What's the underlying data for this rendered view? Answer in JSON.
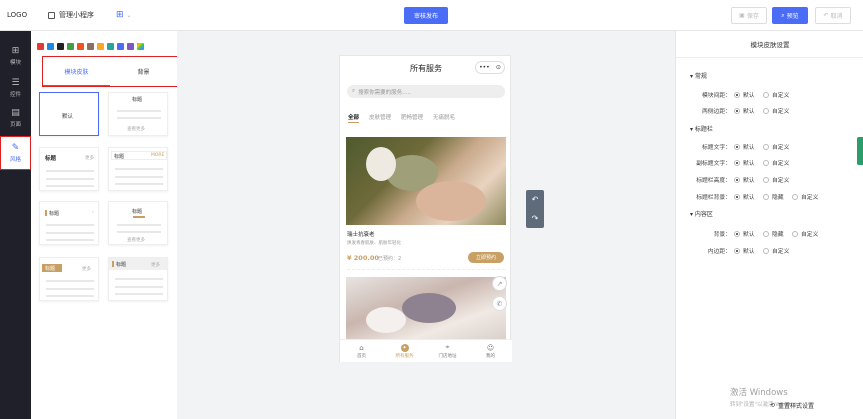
{
  "header": {
    "logo": "LOGO",
    "manage": "管理小程序",
    "submit": "审核发布",
    "save": "保存",
    "preview": "预览",
    "cancel": "取消"
  },
  "nav": [
    {
      "icon": "plus-square-icon",
      "glyph": "⊞",
      "label": "模块"
    },
    {
      "icon": "sliders-icon",
      "glyph": "☰",
      "label": "控件"
    },
    {
      "icon": "page-icon",
      "glyph": "▤",
      "label": "页面"
    },
    {
      "icon": "magic-wand-icon",
      "glyph": "✎",
      "label": "风格"
    }
  ],
  "swatch_colors": [
    "#e53935",
    "#1e88e5",
    "#212121",
    "#43a047",
    "#f4511e",
    "#8d6e63",
    "#f9a825",
    "#26a69a",
    "#4a6cf7",
    "#7e57c2"
  ],
  "skin_panel": {
    "tab_module": "模块皮肤",
    "tab_bg": "背景",
    "default": "默认",
    "title": "标题",
    "more": "查看更多",
    "more_short": "更多"
  },
  "phone": {
    "title": "所有服务",
    "capsule_more": "•••",
    "capsule_close": "⊙",
    "search_placeholder": "搜索你需要的服务.....",
    "tabs": [
      "全部",
      "皮肤管理",
      "肥畅管理",
      "无痛脱毛"
    ],
    "item_title": "瑞士抗衰老",
    "item_sub": "焕发青春肌肤、肌肤年轻化",
    "price": "¥ 200.00",
    "sold": "已预约：2",
    "book": "立即预约",
    "tabbar": [
      "首页",
      "所有服务",
      "门店地址",
      "我的"
    ]
  },
  "settings": {
    "header": "模块皮肤设置",
    "sec_general": "常规",
    "sec_titlebar": "标题栏",
    "sec_content": "内容区",
    "rows": {
      "module_spacing": "模块间距：",
      "side_margin": "两侧边距：",
      "title_text": "标题文字：",
      "subtitle_text": "副标题文字：",
      "title_height": "标题栏高度：",
      "title_bg": "标题栏背景：",
      "bg": "背景：",
      "padding": "内边距："
    },
    "opt_default": "默认",
    "opt_custom": "自定义",
    "opt_hidden": "隐藏",
    "reset": "重置样式设置"
  },
  "watermark": {
    "line1": "激活 Windows",
    "line2": "转到\"设置\"以激活 Windows。"
  }
}
